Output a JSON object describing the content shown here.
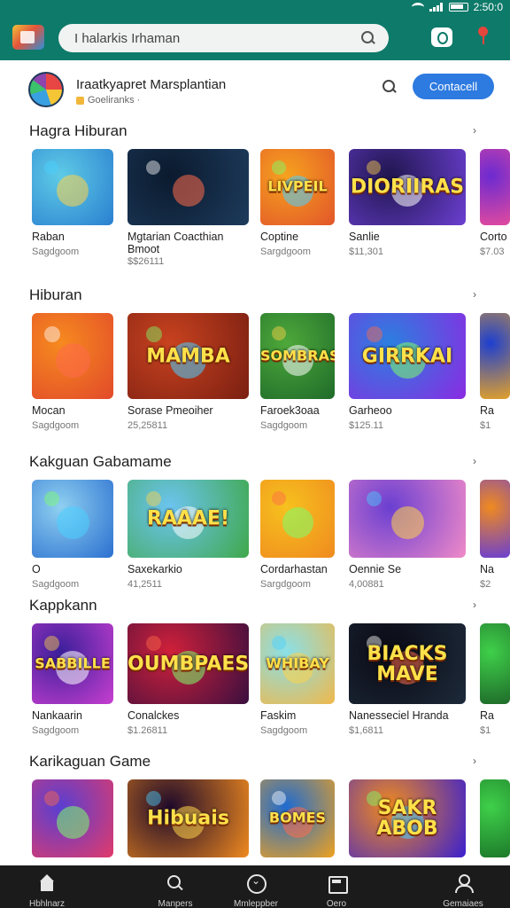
{
  "search": {
    "value": "I halarkis Irhaman"
  },
  "developer": {
    "name": "Iraatkyapret Marsplantian",
    "subtitle": "Goeliranks ·",
    "action_label": "Contacell"
  },
  "sections": [
    {
      "title": "Hagra Hiburan",
      "more": "›",
      "cards": [
        {
          "name": "Raban",
          "price": "Sagdgoom",
          "art": "",
          "icon": "robot-art-icon"
        },
        {
          "name": "Mgtarian Coacthian Bmoot",
          "price": "$$26111",
          "art": "",
          "icon": "gamepad-art-icon"
        },
        {
          "name": "Coptine",
          "price": "Sargdgoom",
          "art": "LIVPEIL",
          "icon": "cube-art-icon"
        },
        {
          "name": "Sanlie",
          "price": "$11,301",
          "art": "DIORIIRAS",
          "icon": "emblem-art-icon"
        },
        {
          "name": "Corto",
          "price": "$7.03",
          "art": "",
          "icon": "gem-art-icon"
        }
      ]
    },
    {
      "title": "Hiburan",
      "more": "›",
      "cards": [
        {
          "name": "Mocan",
          "price": "Sagdgoom",
          "art": "",
          "icon": "hero-art-icon"
        },
        {
          "name": "Sorase Pmeoiher",
          "price": "25,25811",
          "art": "MAMBA",
          "icon": "monkey-art-icon"
        },
        {
          "name": "Faroek3oaa",
          "price": "Sagdgoom",
          "art": "SOMBRAS",
          "icon": "zombie-art-icon"
        },
        {
          "name": "Garheoo",
          "price": "$125.11",
          "art": "GIRRKAI",
          "icon": "treasure-art-icon"
        },
        {
          "name": "Ra",
          "price": "$1",
          "art": "",
          "icon": "game-art-icon"
        }
      ]
    },
    {
      "title": "Kakguan Gabamame",
      "more": "›",
      "cards": [
        {
          "name": "O",
          "price": "Sagdgoom",
          "art": "",
          "icon": "car-art-icon"
        },
        {
          "name": "Saxekarkio",
          "price": "41,2511",
          "art": "RAAAE!",
          "icon": "runner-art-icon"
        },
        {
          "name": "Cordarhastan",
          "price": "Sargdgoom",
          "art": "",
          "icon": "bomb-art-icon"
        },
        {
          "name": "Oennie Se",
          "price": "4,00881",
          "art": "",
          "icon": "party-art-icon"
        },
        {
          "name": "Na",
          "price": "$2",
          "art": "",
          "icon": "game-art-icon"
        }
      ]
    },
    {
      "title": "Kappkann",
      "more": "›",
      "cards": [
        {
          "name": "Nankaarin",
          "price": "Sagdgoom",
          "art": "SABBILLE",
          "icon": "dice-art-icon"
        },
        {
          "name": "Conalckes",
          "price": "$1.26811",
          "art": "OUMBPAES",
          "icon": "soldier-art-icon"
        },
        {
          "name": "Faskim",
          "price": "Sagdgoom",
          "art": "WHIBAY",
          "icon": "controller-art-icon"
        },
        {
          "name": "Nanesseciel Hranda",
          "price": "$1,6811",
          "art": "BIACKS MAVE",
          "icon": "blob-art-icon"
        },
        {
          "name": "Ra",
          "price": "$1",
          "art": "",
          "icon": "game-art-icon"
        }
      ]
    },
    {
      "title": "Karikaguan Game",
      "more": "›",
      "cards": [
        {
          "name": "",
          "price": "",
          "art": "",
          "icon": "rocket-art-icon"
        },
        {
          "name": "",
          "price": "",
          "art": "Hibuais",
          "icon": "gamepad-art-icon"
        },
        {
          "name": "",
          "price": "",
          "art": "BOMES",
          "icon": "controller-art-icon"
        },
        {
          "name": "",
          "price": "",
          "art": "SAKR ABOB",
          "icon": "wizard-art-icon"
        },
        {
          "name": "",
          "price": "",
          "art": "",
          "icon": "game-art-icon"
        }
      ]
    }
  ],
  "nav": [
    {
      "label": "Hbhlnarz",
      "icon": "home-icon"
    },
    {
      "label": "Manpers",
      "icon": "search-icon"
    },
    {
      "label": "Mmleppber",
      "icon": "compass-icon"
    },
    {
      "label": "Oero",
      "icon": "store-icon"
    },
    {
      "label": "Gemaiaes",
      "icon": "profile-icon"
    }
  ],
  "status": {
    "time": "2:50:0"
  }
}
